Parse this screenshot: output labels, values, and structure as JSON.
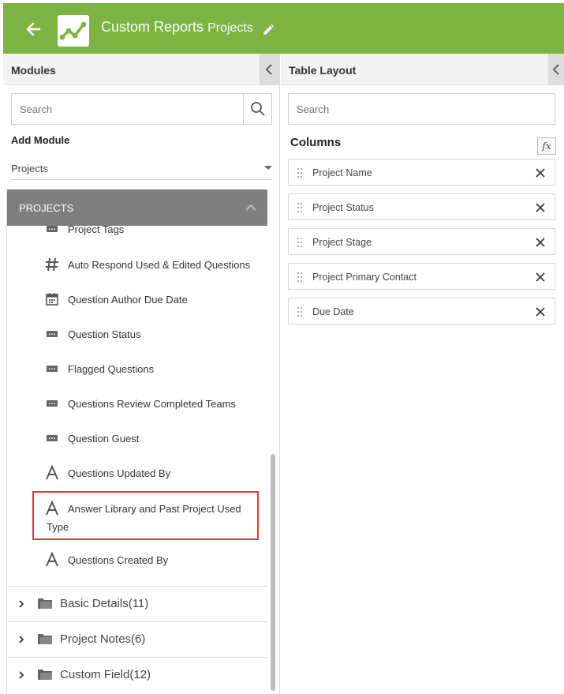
{
  "header": {
    "title": "Custom Reports",
    "subtitle": "Projects",
    "back_icon": "arrow-left-icon",
    "logo_icon": "line-chart-logo-icon",
    "edit_icon": "pencil-icon",
    "color": "#7cb342"
  },
  "modules_panel": {
    "title": "Modules",
    "search_placeholder": "Search",
    "add_module_label": "Add Module",
    "selected_module": "Projects",
    "group": {
      "label": "PROJECTS",
      "fields": [
        {
          "label": "Project Tags",
          "icon": "picklist-icon"
        },
        {
          "label": "Auto Respond Used & Edited Questions",
          "icon": "hash-icon"
        },
        {
          "label": "Question Author Due Date",
          "icon": "calendar-icon"
        },
        {
          "label": "Question Status",
          "icon": "picklist-icon"
        },
        {
          "label": "Flagged Questions",
          "icon": "picklist-icon"
        },
        {
          "label": "Questions Review Completed Teams",
          "icon": "picklist-icon"
        },
        {
          "label": "Question Guest",
          "icon": "picklist-icon"
        },
        {
          "label": "Questions Updated By",
          "icon": "text-icon"
        },
        {
          "label": "Answer Library and Past Project Used Type",
          "icon": "text-icon",
          "highlighted": true
        },
        {
          "label": "Questions Created By",
          "icon": "text-icon"
        }
      ]
    },
    "folders": [
      {
        "label": "Basic Details(11)"
      },
      {
        "label": "Project Notes(6)"
      },
      {
        "label": "Custom Field(12)"
      }
    ],
    "highlight_color": "#e53935"
  },
  "layout_panel": {
    "title": "Table Layout",
    "search_placeholder": "Search",
    "columns_label": "Columns",
    "fx_label": "fx",
    "columns": [
      {
        "label": "Project Name"
      },
      {
        "label": "Project Status"
      },
      {
        "label": "Project Stage"
      },
      {
        "label": "Project Primary Contact"
      },
      {
        "label": "Due Date"
      }
    ]
  }
}
